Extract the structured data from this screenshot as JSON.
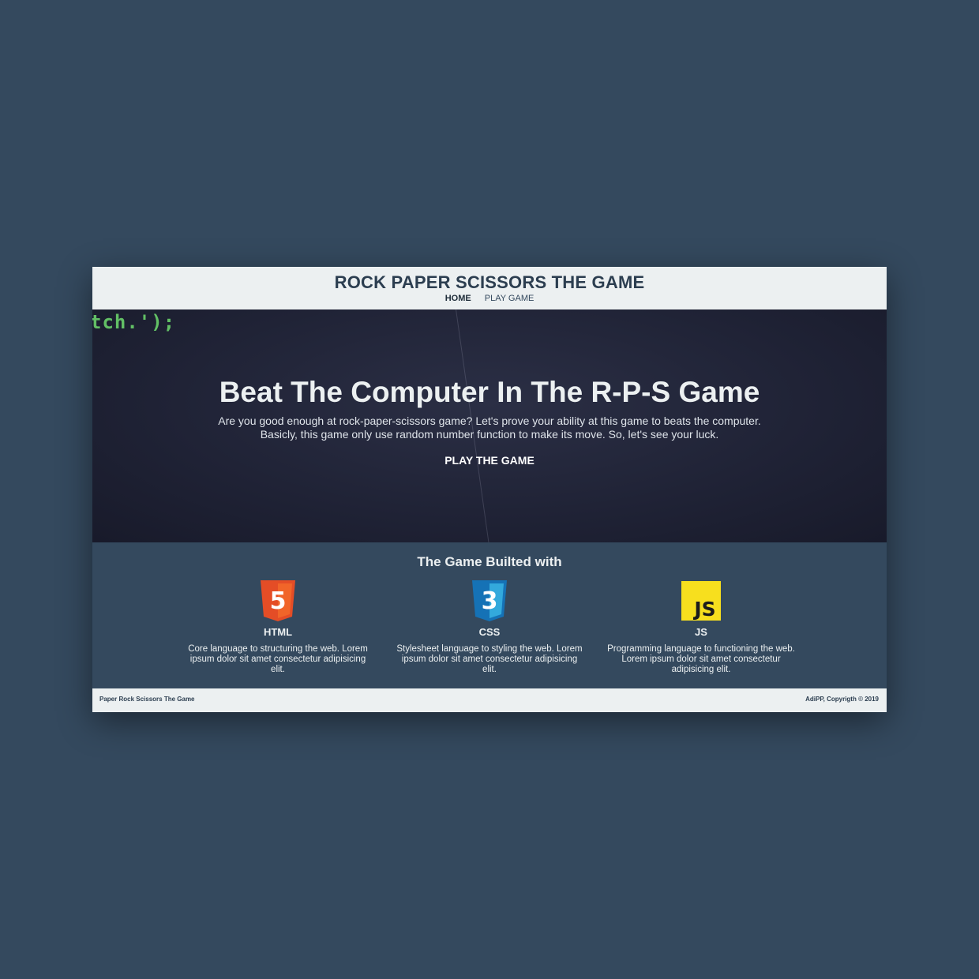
{
  "header": {
    "title": "ROCK PAPER SCISSORS THE GAME",
    "nav": [
      {
        "label": "HOME",
        "active": true
      },
      {
        "label": "PLAY GAME",
        "active": false
      }
    ]
  },
  "hero": {
    "code_text": "tch.');",
    "title": "Beat The Computer In The R-P-S Game",
    "description_line1": "Are you good enough at rock-paper-scissors game? Let's prove your ability at this game to beats the computer.",
    "description_line2": "Basicly, this game only use random number function to make its move. So, let's see your luck.",
    "cta_label": "PLAY THE GAME"
  },
  "built": {
    "title": "The Game Builted with",
    "items": [
      {
        "icon": "html5-icon",
        "logo_text": "5",
        "name": "HTML",
        "description": "Core language to structuring the web. Lorem ipsum dolor sit amet consectetur adipisicing elit.",
        "color": "#e44d26"
      },
      {
        "icon": "css3-icon",
        "logo_text": "3",
        "name": "CSS",
        "description": "Stylesheet language to styling the web. Lorem ipsum dolor sit amet consectetur adipisicing elit.",
        "color": "#1572b6"
      },
      {
        "icon": "javascript-icon",
        "logo_text": "JS",
        "name": "JS",
        "description": "Programming language to functioning the web. Lorem ipsum dolor sit amet consectetur adipisicing elit.",
        "color": "#f7df1e"
      }
    ]
  },
  "footer": {
    "left": "Paper Rock Scissors The Game",
    "right": "AdiPP, Copyrigth © 2019"
  },
  "colors": {
    "page_bg": "#34495e",
    "header_bg": "#ecf0f1",
    "hero_bg": "#1f2235",
    "code_green": "#6fdc6f"
  }
}
